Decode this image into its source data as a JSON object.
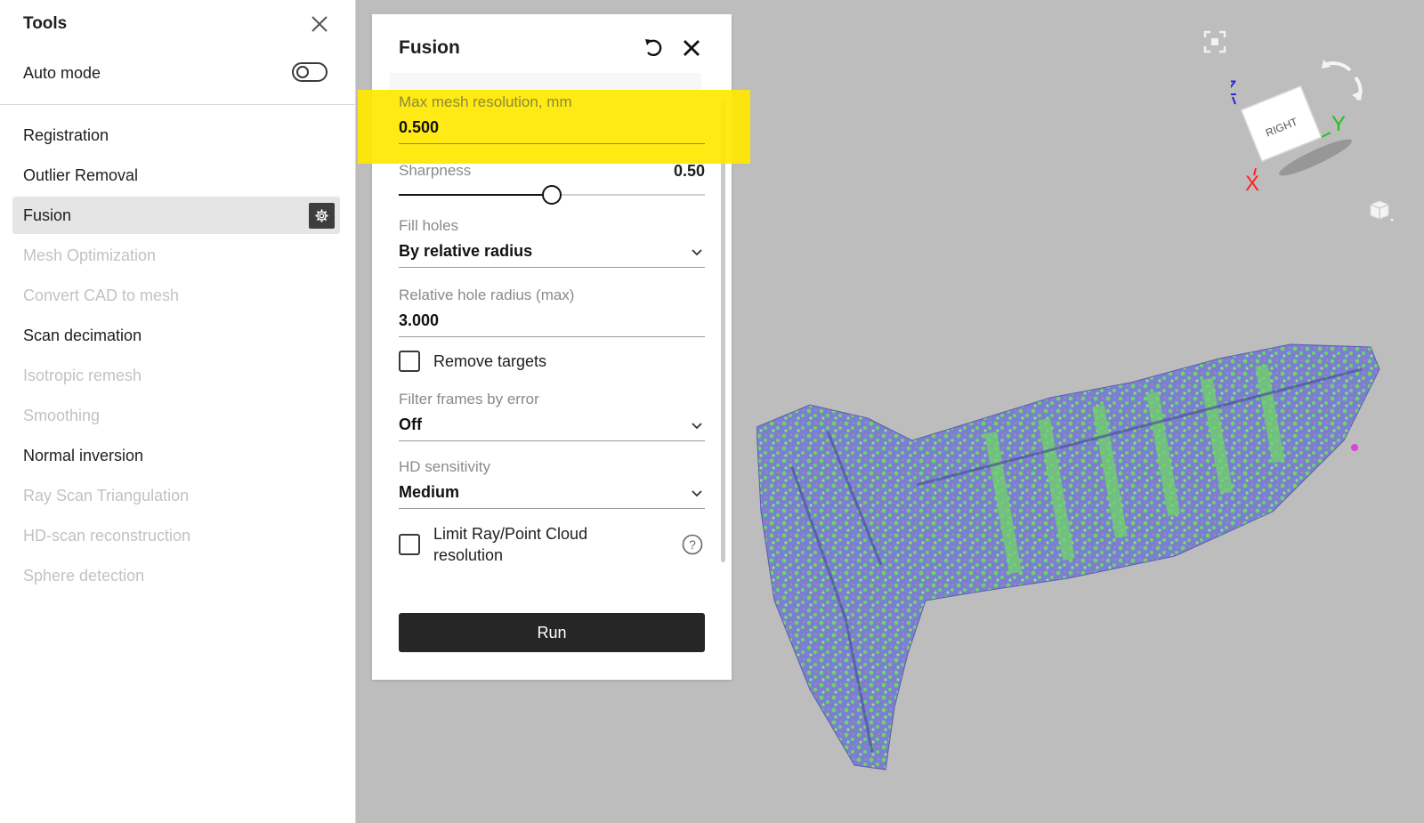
{
  "tools_panel": {
    "title": "Tools",
    "auto_mode_label": "Auto mode",
    "auto_mode_on": false,
    "items": [
      {
        "label": "Registration",
        "state": "enabled"
      },
      {
        "label": "Outlier Removal",
        "state": "enabled"
      },
      {
        "label": "Fusion",
        "state": "selected"
      },
      {
        "label": "Mesh Optimization",
        "state": "disabled"
      },
      {
        "label": "Convert CAD to mesh",
        "state": "disabled"
      },
      {
        "label": "Scan decimation",
        "state": "enabled"
      },
      {
        "label": "Isotropic remesh",
        "state": "disabled"
      },
      {
        "label": "Smoothing",
        "state": "disabled"
      },
      {
        "label": "Normal inversion",
        "state": "enabled"
      },
      {
        "label": "Ray Scan Triangulation",
        "state": "disabled"
      },
      {
        "label": "HD-scan reconstruction",
        "state": "disabled"
      },
      {
        "label": "Sphere detection",
        "state": "disabled"
      }
    ]
  },
  "fusion_panel": {
    "title": "Fusion",
    "max_mesh_resolution": {
      "label": "Max mesh resolution, mm",
      "value": "0.500"
    },
    "sharpness": {
      "label": "Sharpness",
      "value": "0.50",
      "fraction": 0.5
    },
    "fill_holes": {
      "label": "Fill holes",
      "value": "By relative radius"
    },
    "relative_hole_radius": {
      "label": "Relative hole radius (max)",
      "value": "3.000"
    },
    "remove_targets": {
      "label": "Remove targets",
      "checked": false
    },
    "filter_frames": {
      "label": "Filter frames by error",
      "value": "Off"
    },
    "hd_sensitivity": {
      "label": "HD sensitivity",
      "value": "Medium"
    },
    "limit_resolution": {
      "label_line1": "Limit Ray/Point Cloud",
      "label_line2": "resolution",
      "checked": false
    },
    "run_label": "Run"
  },
  "view_cube": {
    "face_label": "RIGHT",
    "axis_x": "X",
    "axis_y": "Y",
    "axis_z": "Z"
  },
  "colors": {
    "highlight": "#ffe800",
    "viewport_bg": "#bdbdbd",
    "mesh_blue": "#7b7fd0",
    "mesh_green": "#6fd36a",
    "axis_x": "#ff2020",
    "axis_y": "#22c022",
    "axis_z": "#2020e0"
  }
}
